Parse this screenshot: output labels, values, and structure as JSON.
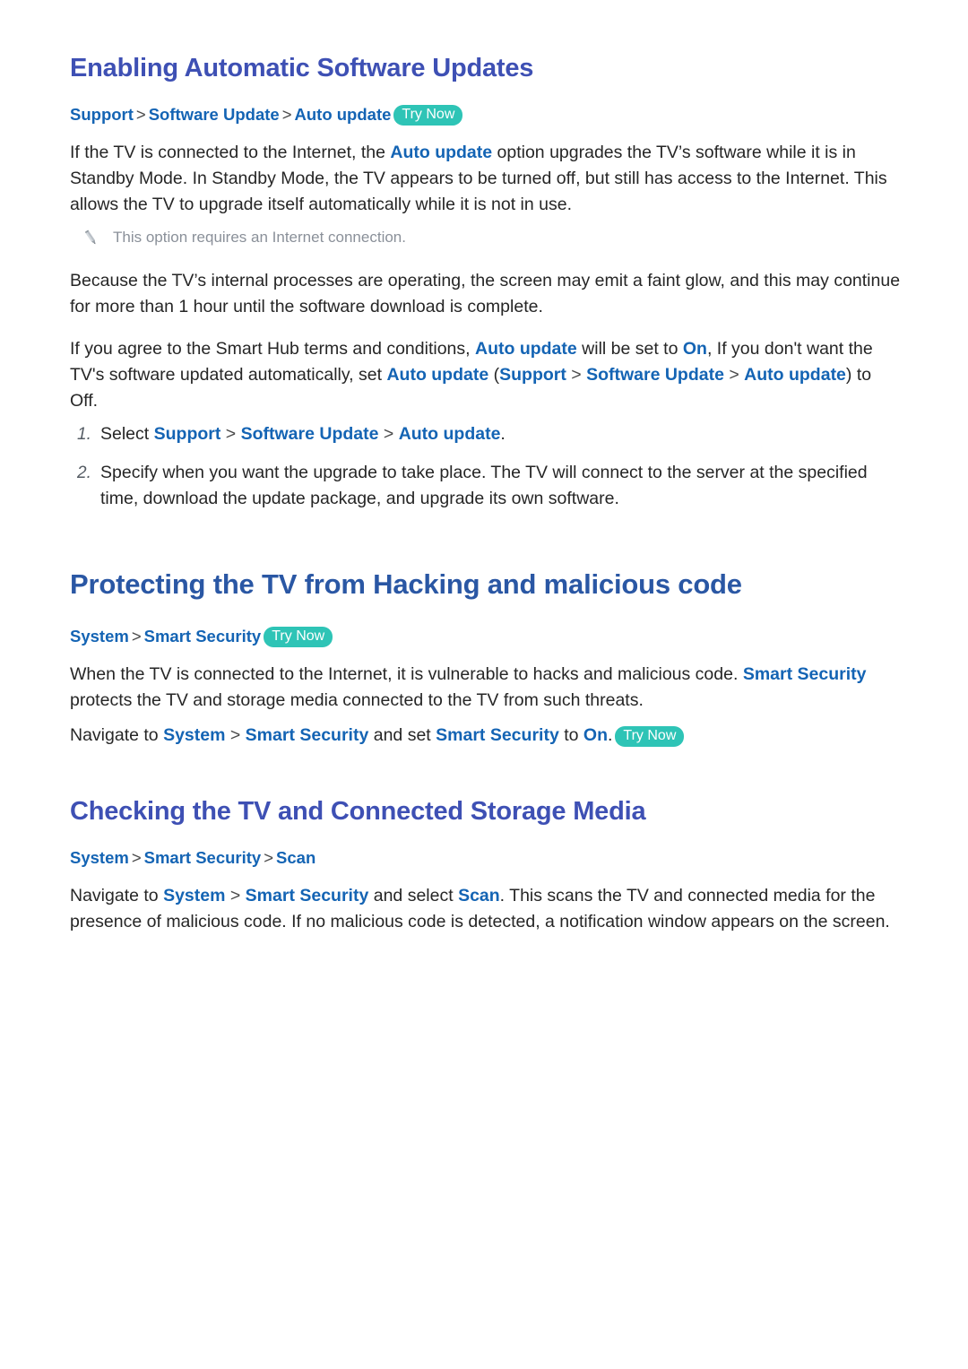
{
  "colors": {
    "heading_light": "#3e50b4",
    "heading_deep": "#2a57a4",
    "link": "#1464b4",
    "body_text": "#262626",
    "note_text": "#8a9099",
    "trynow_bg": "#2ec4b6",
    "trynow_text": "#ffffff",
    "page_bg": "#ffffff"
  },
  "sections": {
    "s1": {
      "heading": "Enabling Automatic Software Updates",
      "breadcrumb": {
        "items": [
          "Support",
          "Software Update",
          "Auto update"
        ],
        "separator": ">",
        "badge": "Try Now"
      },
      "para1": {
        "a": "If the TV is connected to the Internet, the ",
        "link1": "Auto update",
        "b": " option upgrades the TV’s software while it is in Standby Mode. In Standby Mode, the TV appears to be turned off, but still has access to the Internet. This allows the TV to upgrade itself automatically while it is not in use."
      },
      "note": {
        "icon": "pencil-icon",
        "text": "This option requires an Internet connection."
      },
      "para2": "Because the TV’s internal processes are operating, the screen may emit a faint glow, and this may continue for more than 1 hour until the software download is complete.",
      "para3": {
        "a": "If you agree to the Smart Hub terms and conditions, ",
        "link1": "Auto update",
        "b": " will be set to ",
        "link2": "On",
        "c": ", If you don't want the TV's software updated automatically, set ",
        "link3": "Auto update",
        "d": " (",
        "link4": "Support",
        "sep1": ">",
        "link5": "Software Update",
        "sep2": ">",
        "link6": "Auto update",
        "e": ") to Off."
      },
      "steps": [
        {
          "number": "1.",
          "a": "Select ",
          "link1": "Support",
          "sep1": ">",
          "link2": "Software Update",
          "sep2": ">",
          "link3": "Auto update",
          "b": "."
        },
        {
          "number": "2.",
          "text": "Specify when you want the upgrade to take place. The TV will connect to the server at the specified time, download the update package, and upgrade its own software."
        }
      ]
    },
    "s2": {
      "heading": "Protecting the TV from Hacking and malicious code",
      "breadcrumb": {
        "items": [
          "System",
          "Smart Security"
        ],
        "separator": ">",
        "badge": "Try Now"
      },
      "para1": {
        "a": "When the TV is connected to the Internet, it is vulnerable to hacks and malicious code. ",
        "link1": "Smart Security",
        "b": " protects the TV and storage media connected to the TV from such threats."
      },
      "para2": {
        "a": "Navigate to ",
        "link1": "System",
        "sep1": ">",
        "link2": "Smart Security",
        "b": " and set ",
        "link3": "Smart Security",
        "c": " to ",
        "link4": "On",
        "d": ".",
        "badge": "Try Now"
      }
    },
    "s3": {
      "heading": "Checking the TV and Connected Storage Media",
      "breadcrumb": {
        "items": [
          "System",
          "Smart Security",
          "Scan"
        ],
        "separator": ">"
      },
      "para1": {
        "a": "Navigate to ",
        "link1": "System",
        "sep1": ">",
        "link2": "Smart Security",
        "b": " and select ",
        "link3": "Scan",
        "c": ". This scans the TV and connected media for the presence of malicious code. If no malicious code is detected, a notification window appears on the screen."
      }
    }
  }
}
